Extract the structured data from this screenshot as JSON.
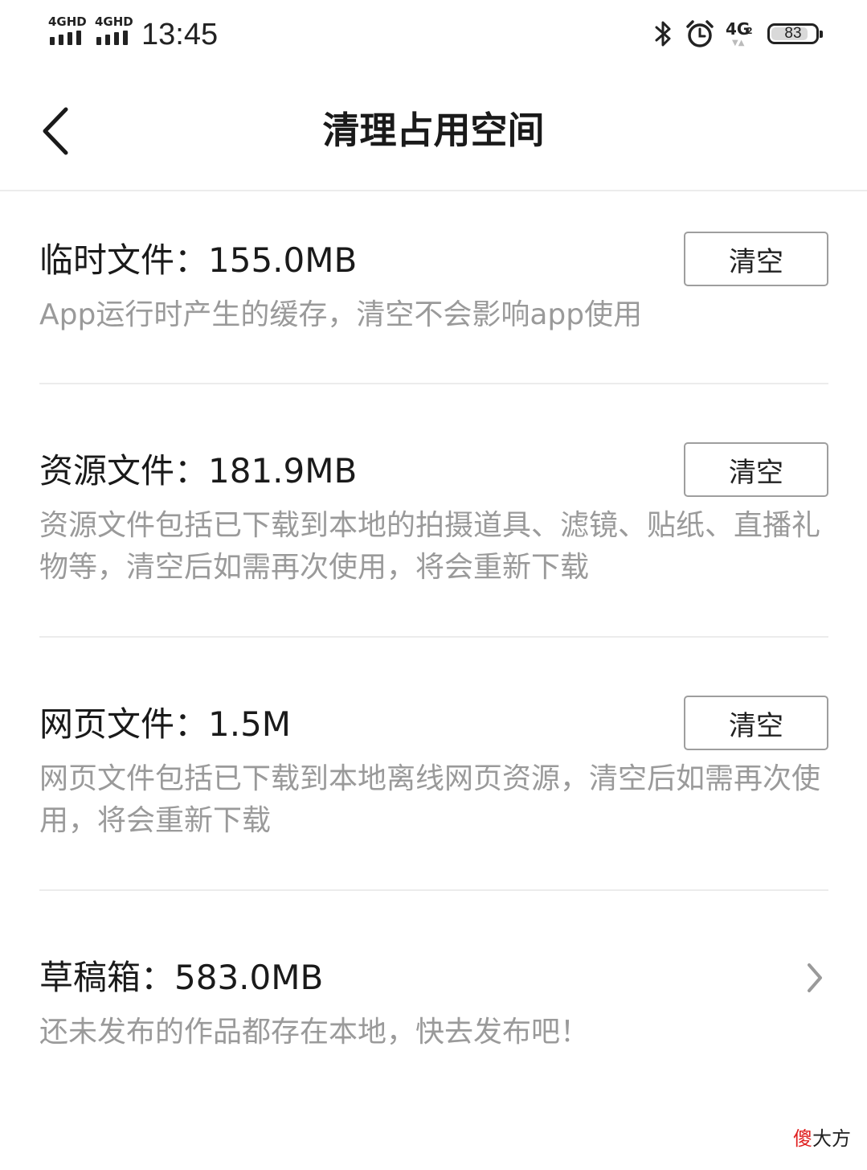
{
  "status_bar": {
    "sim1_label": "4GHD",
    "sim2_label": "4GHD",
    "time": "13:45",
    "bluetooth_icon": "bluetooth-icon",
    "alarm_icon": "alarm-icon",
    "network_label": "4G",
    "network_sub": "2",
    "battery_level": "83",
    "battery_fraction": 0.83
  },
  "nav": {
    "back_icon": "chevron-left-icon",
    "title": "清理占用空间"
  },
  "sections": [
    {
      "title": "临时文件：155.0MB",
      "description": "App运行时产生的缓存，清空不会影响app使用",
      "button": "清空"
    },
    {
      "title": "资源文件：181.9MB",
      "description": "资源文件包括已下载到本地的拍摄道具、滤镜、贴纸、直播礼物等，清空后如需再次使用，将会重新下载",
      "button": "清空"
    },
    {
      "title": "网页文件：1.5M",
      "description": "网页文件包括已下载到本地离线网页资源，清空后如需再次使用，将会重新下载",
      "button": "清空"
    },
    {
      "title": "草稿箱：583.0MB",
      "description": "还未发布的作品都存在本地，快去发布吧！",
      "chevron_icon": "chevron-right-icon"
    }
  ],
  "watermark": {
    "part1": "傻",
    "part2": "大方"
  },
  "colors": {
    "text_primary": "#1a1a1a",
    "text_secondary": "#9a9a9a",
    "divider": "#ececec",
    "button_border": "#9e9e9e"
  }
}
